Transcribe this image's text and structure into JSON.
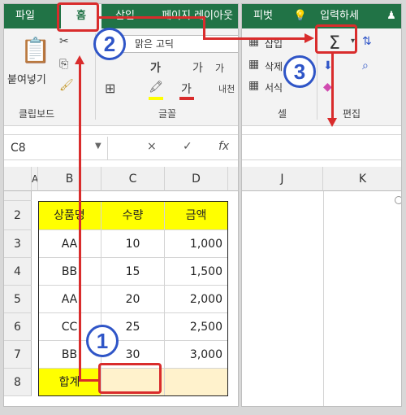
{
  "left_ribbon": {
    "tabs": [
      "파일",
      "홈",
      "삽입",
      "페이지 레이아웃"
    ],
    "font_name": "맑은 고딕",
    "paste_label": "붙여넣기",
    "clipboard_label": "클립보드",
    "font_group_label": "글꼴",
    "bold": "가",
    "bigger": "가",
    "smaller": "가",
    "font_color_glyph": "가",
    "wrap_label": "내천"
  },
  "right_ribbon": {
    "tabs": [
      "피벗",
      "입력하세"
    ],
    "insert_label": "삽입",
    "delete_label": "삭제",
    "format_label": "서식",
    "cells_group_label": "셀",
    "edit_group_label": "편집",
    "sigma": "Σ"
  },
  "formula": {
    "name_box": "C8",
    "cancel": "×",
    "enter": "✓",
    "fx": "fx"
  },
  "grid": {
    "columns_left": [
      "A",
      "B",
      "C",
      "D"
    ],
    "columns_right": [
      "J",
      "K"
    ],
    "rows": [
      "2",
      "3",
      "4",
      "5",
      "6",
      "7",
      "8"
    ],
    "header": [
      "상품명",
      "수량",
      "금액"
    ],
    "data": [
      [
        "AA",
        "10",
        "1,000"
      ],
      [
        "BB",
        "15",
        "1,500"
      ],
      [
        "AA",
        "20",
        "2,000"
      ],
      [
        "CC",
        "25",
        "2,500"
      ],
      [
        "BB",
        "30",
        "3,000"
      ]
    ],
    "total_label": "합계"
  },
  "annotations": {
    "step1": "1",
    "step2": "2",
    "step3": "3"
  },
  "colors": {
    "excel_green": "#217346",
    "header_yellow": "#ffff00",
    "sum_fill": "#fff2cc",
    "annotation_red": "#d92c2c",
    "badge_blue": "#2f55c7"
  }
}
